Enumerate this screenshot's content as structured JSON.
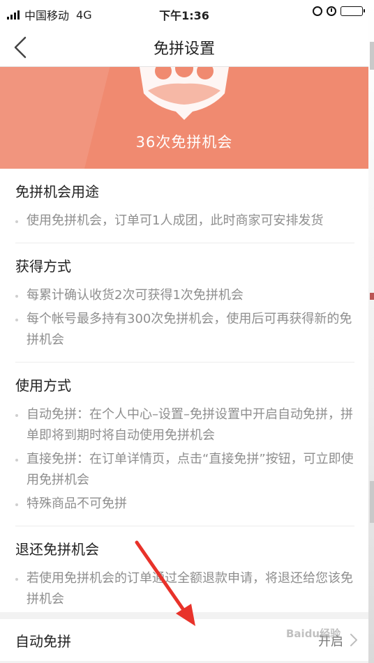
{
  "status_bar": {
    "carrier": "中国移动",
    "network": "4G",
    "time": "下午1:36"
  },
  "nav": {
    "title": "免拼设置"
  },
  "banner": {
    "text": "36次免拼机会",
    "bg_color": "#f08a70"
  },
  "sections": [
    {
      "title": "免拼机会用途",
      "items": [
        "使用免拼机会，订单可1人成团，此时商家可安排发货"
      ]
    },
    {
      "title": "获得方式",
      "items": [
        "每累计确认收货2次可获得1次免拼机会",
        "每个帐号最多持有300次免拼机会，使用后可再获得新的免拼机会"
      ]
    },
    {
      "title": "使用方式",
      "items": [
        "自动免拼：在个人中心–设置–免拼设置中开启自动免拼，拼单即将到期时将自动使用免拼机会",
        "直接免拼：在订单详情页，点击“直接免拼”按钮，可立即使用免拼机会",
        "特殊商品不可免拼"
      ]
    },
    {
      "title": "退还免拼机会",
      "items": [
        "若使用免拼机会的订单通过全额退款申请，将退还给您该免拼机会"
      ]
    }
  ],
  "auto_pin": {
    "label": "自动免拼",
    "status": "开启"
  },
  "watermark": "Baidu经验",
  "annotation_color": "#e8322a"
}
